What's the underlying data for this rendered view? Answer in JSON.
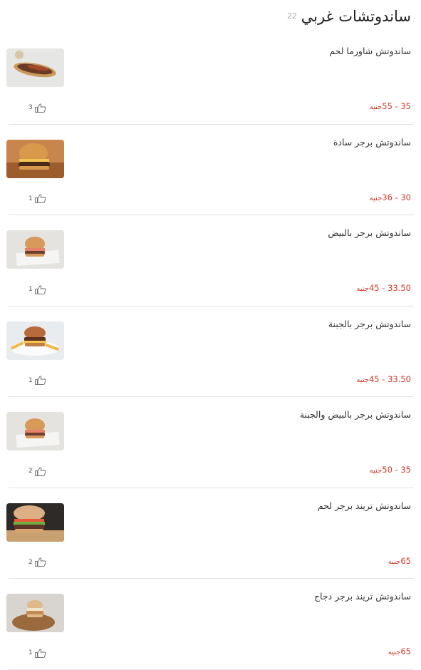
{
  "header": {
    "title": "ساندوتشات غربي",
    "count": "22"
  },
  "currency": "جنيه",
  "icons": {
    "like": "thumbs-up-icon"
  },
  "items": [
    {
      "name": "ساندوتش شاورما لحم",
      "price": "35 - 55",
      "likes": "3",
      "thumb_type": "shawarma"
    },
    {
      "name": "ساندوتش برجر سادة",
      "price": "30 - 36",
      "likes": "1",
      "thumb_type": "burger-wood"
    },
    {
      "name": "ساندوتش برجر بالبيض",
      "price": "33.50 - 45",
      "likes": "1",
      "thumb_type": "burger-plate"
    },
    {
      "name": "ساندوتش برجر بالجبنة",
      "price": "33.50 - 45",
      "likes": "1",
      "thumb_type": "burger-fries"
    },
    {
      "name": "ساندوتش برجر بالبيض والجبنة",
      "price": "35 - 50",
      "likes": "2",
      "thumb_type": "burger-plate"
    },
    {
      "name": "ساندوتش تريند برجر لحم",
      "price": "65",
      "likes": "2",
      "thumb_type": "burger-dark"
    },
    {
      "name": "ساندوتش تريند برجر دجاج",
      "price": "65",
      "likes": "1",
      "thumb_type": "burger-board"
    }
  ]
}
